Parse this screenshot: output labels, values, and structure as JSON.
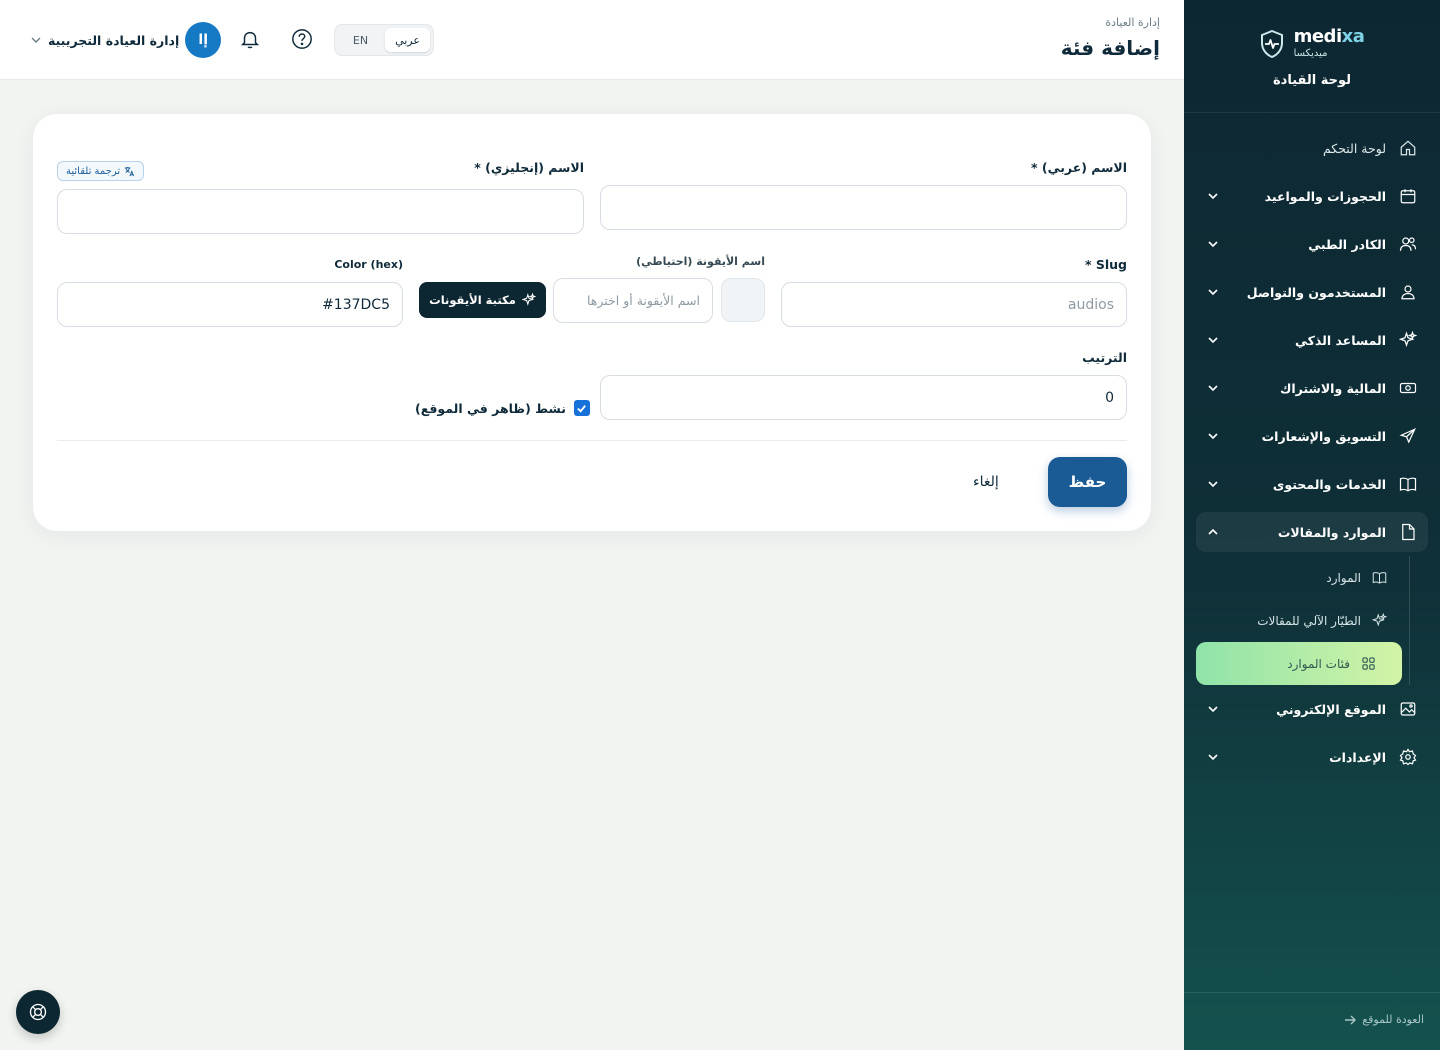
{
  "brand": {
    "name_main": "medi",
    "name_accent": "xa",
    "subtitle": "ميديكسا",
    "panel_title": "لوحة القيادة"
  },
  "header": {
    "breadcrumb": "إدارة العيادة",
    "title": "إضافة فئة",
    "lang": {
      "ar": "عربي",
      "en": "EN",
      "selected": "عربي"
    },
    "user": {
      "name": "إدارة العيادة التجريبية",
      "initials": "إا"
    }
  },
  "nav": {
    "items": [
      {
        "label": "لوحة التحكم",
        "icon": "home-icon"
      },
      {
        "label": "الحجوزات والمواعيد",
        "icon": "calendar-icon"
      },
      {
        "label": "الكادر الطبي",
        "icon": "users-icon"
      },
      {
        "label": "المستخدمون والتواصل",
        "icon": "user-icon"
      },
      {
        "label": "المساعد الذكي",
        "icon": "sparkles-icon"
      },
      {
        "label": "المالية والاشتراك",
        "icon": "money-icon"
      },
      {
        "label": "التسويق والإشعارات",
        "icon": "send-icon"
      },
      {
        "label": "الخدمات والمحتوى",
        "icon": "book-icon"
      },
      {
        "label": "الموارد والمقالات",
        "icon": "file-icon"
      },
      {
        "label": "الموقع الإلكتروني",
        "icon": "image-icon"
      },
      {
        "label": "الإعدادات",
        "icon": "gear-icon"
      }
    ],
    "sub_items": [
      {
        "label": "الموارد",
        "icon": "book-open-icon"
      },
      {
        "label": "الطيّار الآلي للمقالات",
        "icon": "sparkles-icon"
      },
      {
        "label": "فئات الموارد",
        "icon": "grid-icon",
        "active": true
      }
    ],
    "back_link": "العودة للموقع"
  },
  "form": {
    "name_ar": {
      "label": "الاسم (عربي) *",
      "value": ""
    },
    "name_en": {
      "label": "الاسم (إنجليزي) *",
      "value": ""
    },
    "auto_translate": "ترجمة تلقائية",
    "slug": {
      "label": "Slug *",
      "placeholder": "audios",
      "value": ""
    },
    "icon_name": {
      "label": "اسم الأيقونة (احتياطي)",
      "placeholder": "اسم الأيقونة أو اخترها",
      "value": ""
    },
    "icon_library_button": "مكتبة الأيقونات",
    "color": {
      "label": "Color (hex)",
      "value": "#137DC5"
    },
    "order": {
      "label": "الترتيب",
      "value": "0"
    },
    "active": {
      "label": "نشط (ظاهر في الموقع)",
      "checked": true
    },
    "save_label": "حفظ",
    "cancel_label": "إلغاء"
  },
  "colors": {
    "primary": "#1b5b95",
    "sidebar": "#0d2732",
    "active_nav": "#b8eda6",
    "checkbox": "#1671d8"
  }
}
